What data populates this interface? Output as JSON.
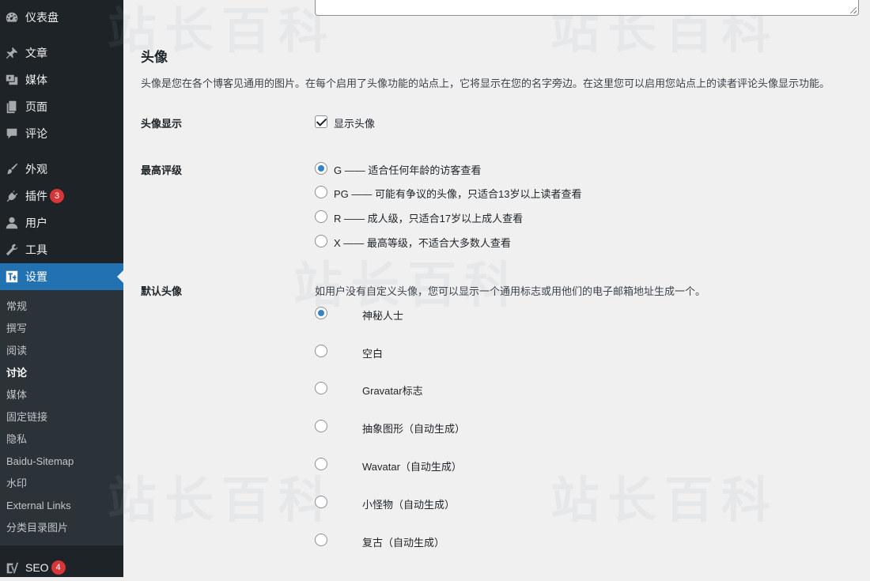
{
  "sidebar": {
    "dashboard": "仪表盘",
    "posts": "文章",
    "media": "媒体",
    "pages": "页面",
    "comments": "评论",
    "appearance": "外观",
    "plugins": "插件",
    "plugins_badge": "3",
    "users": "用户",
    "tools": "工具",
    "settings": "设置",
    "seo": "SEO",
    "seo_badge": "4",
    "submenu": [
      "常规",
      "撰写",
      "阅读",
      "讨论",
      "媒体",
      "固定链接",
      "隐私",
      "Baidu-Sitemap",
      "水印",
      "External Links",
      "分类目录图片"
    ],
    "current_submenu": "讨论"
  },
  "avatars": {
    "title": "头像",
    "description": "头像是您在各个博客见通用的图片。在每个启用了头像功能的站点上，它将显示在您的名字旁边。在这里您可以启用您站点上的读者评论头像显示功能。",
    "display_label": "头像显示",
    "display_option": "显示头像",
    "display_checked": true,
    "rating_label": "最高评级",
    "ratings": [
      "G —— 适合任何年龄的访客查看",
      "PG —— 可能有争议的头像，只适合13岁以上读者查看",
      "R —— 成人级，只适合17岁以上成人查看",
      "X —— 最高等级，不适合大多数人查看"
    ],
    "rating_selected": "G",
    "default_label": "默认头像",
    "default_description": "如用户没有自定义头像，您可以显示一个通用标志或用他们的电子邮箱地址生成一个。",
    "defaults": [
      "神秘人士",
      "空白",
      "Gravatar标志",
      "抽象图形（自动生成）",
      "Wavatar（自动生成）",
      "小怪物（自动生成）",
      "复古（自动生成）"
    ],
    "default_selected": "神秘人士"
  },
  "watermark_text": "站长百科",
  "colors": {
    "sidebar_bg": "#1d2327",
    "submenu_bg": "#2c3338",
    "accent": "#2271b1",
    "radio_dot": "#3582c4",
    "badge": "#d63638",
    "page_bg": "#f0f0f1"
  }
}
